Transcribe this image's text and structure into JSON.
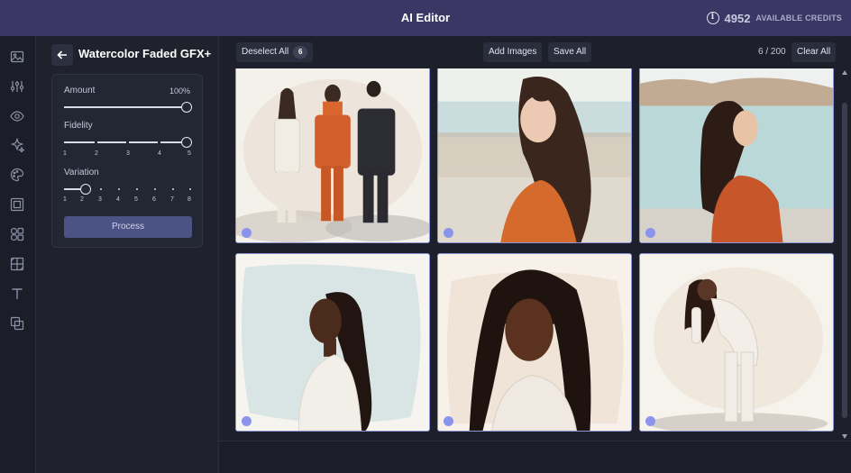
{
  "header": {
    "title": "AI Editor",
    "credits_value": "4952",
    "credits_label": "AVAILABLE CREDITS",
    "info_icon": "info-icon"
  },
  "toolrail": {
    "items": [
      "image-icon",
      "adjust-sliders-icon",
      "eye-icon",
      "sparkle-effects-icon",
      "palette-icon",
      "frame-icon",
      "shapes-icon",
      "texture-icon",
      "text-icon",
      "overlay-icon"
    ]
  },
  "panel": {
    "title": "Watercolor Faded GFX+",
    "amount": {
      "label": "Amount",
      "value_text": "100%",
      "value": 1.0
    },
    "fidelity": {
      "label": "Fidelity",
      "ticks": [
        "1",
        "2",
        "3",
        "4",
        "5"
      ],
      "value": 5
    },
    "variation": {
      "label": "Variation",
      "ticks": [
        "1",
        "2",
        "3",
        "4",
        "5",
        "6",
        "7",
        "8"
      ],
      "value": 2
    },
    "process_label": "Process"
  },
  "toolbar": {
    "deselect_label": "Deselect All",
    "selected_count": "6",
    "add_images_label": "Add Images",
    "save_all_label": "Save All",
    "image_count": "6 / 200",
    "clear_all_label": "Clear All"
  },
  "colors": {
    "header_bg": "#3a3764",
    "accent": "#8a94ea",
    "process_button": "#4b5284"
  }
}
